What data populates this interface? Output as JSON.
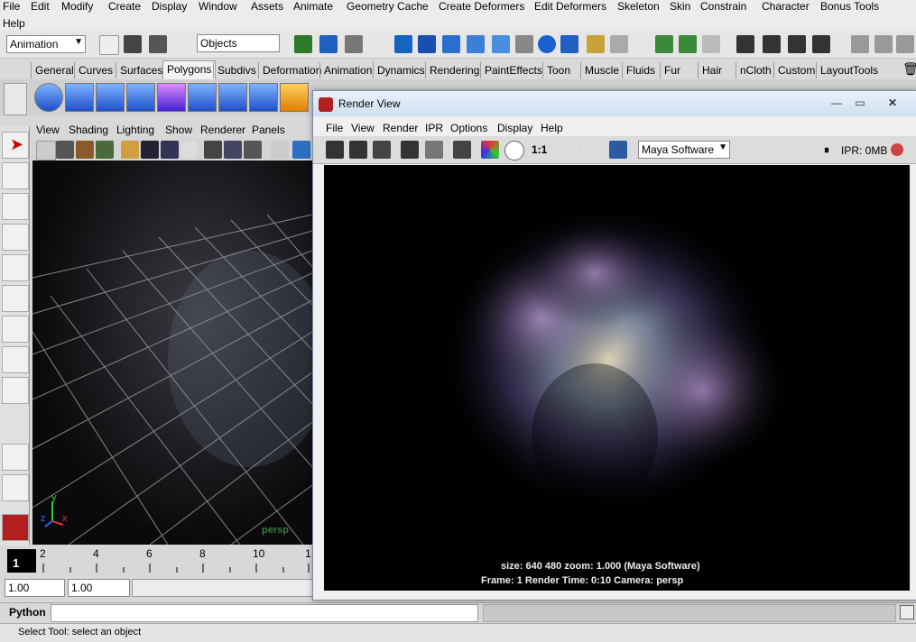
{
  "main_menu": [
    "File",
    "Edit",
    "Modify",
    "Create",
    "Display",
    "Window",
    "Assets",
    "Animate",
    "Geometry Cache",
    "Create Deformers",
    "Edit Deformers",
    "Skeleton",
    "Skin",
    "Constrain",
    "Character",
    "Bonus Tools",
    "Help"
  ],
  "status_line": {
    "menu_set": "Animation",
    "selection_mode": "Objects"
  },
  "shelf_tabs": [
    "General",
    "Curves",
    "Surfaces",
    "Polygons",
    "Subdivs",
    "Deformation",
    "Animation",
    "Dynamics",
    "Rendering",
    "PaintEffects",
    "Toon",
    "Muscle",
    "Fluids",
    "Fur",
    "Hair",
    "nCloth",
    "Custom",
    "LayoutTools"
  ],
  "active_shelf_tab": "Polygons",
  "viewport": {
    "menu": [
      "View",
      "Shading",
      "Lighting",
      "Show",
      "Renderer",
      "Panels"
    ],
    "camera_label": "persp",
    "axis": {
      "x": "x",
      "y": "y",
      "z": "z"
    }
  },
  "time_slider": {
    "ticks": [
      "2",
      "4",
      "6",
      "8",
      "10",
      "1"
    ],
    "current_frame": "1"
  },
  "range_slider": {
    "start": "1.00",
    "end": "1.00"
  },
  "command_line": {
    "label": "Python",
    "value": ""
  },
  "help_line": "Select Tool: select an object",
  "render_view": {
    "title": "Render View",
    "menu": [
      "File",
      "View",
      "Render",
      "IPR",
      "Options",
      "Display",
      "Help"
    ],
    "ratio_label": "1:1",
    "renderer": "Maya Software",
    "ipr_memory": "IPR: 0MB",
    "info_line1": "size:  640  480 zoom: 1.000        (Maya Software)",
    "info_line2": "Frame: 1      Render Time: 0:10      Camera: persp"
  }
}
